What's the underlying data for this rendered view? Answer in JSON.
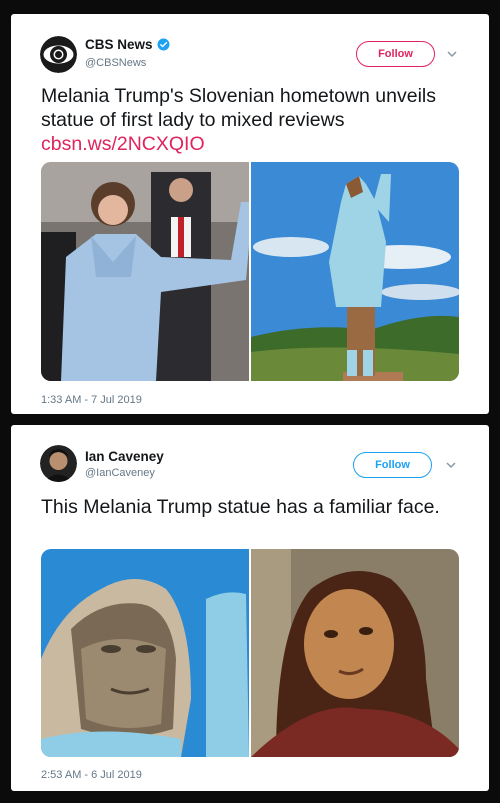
{
  "tweets": [
    {
      "author": "CBS News",
      "handle": "@CBSNews",
      "verified": true,
      "follow_label": "Follow",
      "text": "Melania Trump's Slovenian hometown unveils statue of first lady to mixed reviews",
      "link": "cbsn.ws/2NCXQIO",
      "timestamp": "1:33 AM - 7 Jul 2019",
      "accent": "#e0245e"
    },
    {
      "author": "Ian Caveney",
      "handle": "@IanCaveney",
      "verified": false,
      "follow_label": "Follow",
      "text": "This Melania Trump statue has a familiar face.",
      "timestamp": "2:53 AM - 6 Jul 2019",
      "accent": "#1da1f2"
    }
  ]
}
